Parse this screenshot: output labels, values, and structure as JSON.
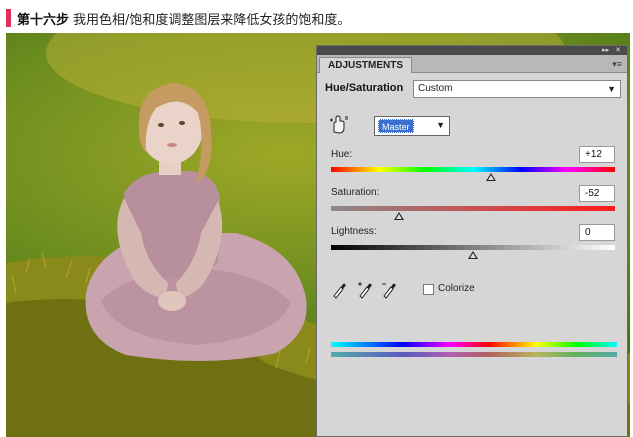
{
  "caption": {
    "step": "第十六步",
    "text": "我用色相/饱和度调整图层来降低女孩的饱和度。"
  },
  "photo": {
    "subject": "girl-in-tulle-dress-on-grass"
  },
  "adjustments_panel": {
    "tab_title": "ADJUSTMENTS",
    "collapse_icon": "double-arrow-icon",
    "close_icon": "close-icon",
    "menu_icon": "panel-menu-icon",
    "hue_saturation_label": "Hue/Saturation",
    "preset_value": "Custom",
    "channel_value": "Master",
    "hue": {
      "label": "Hue:",
      "value": "+12",
      "fraction": 0.565
    },
    "saturation": {
      "label": "Saturation:",
      "value": "-52",
      "fraction": 0.24
    },
    "lightness": {
      "label": "Lightness:",
      "value": "0",
      "fraction": 0.5
    },
    "colorize_label": "Colorize",
    "colorize_checked": false,
    "icons": [
      "hand-adjust-icon",
      "eyedropper-icon",
      "eyedropper-plus-icon",
      "eyedropper-minus-icon"
    ]
  }
}
